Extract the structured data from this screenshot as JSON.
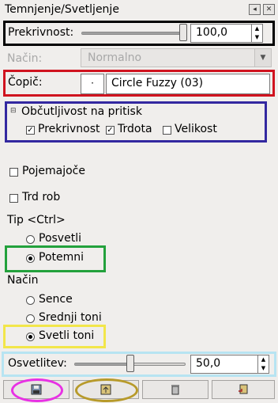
{
  "window": {
    "title": "Temnjenje/Svetljenje",
    "menu_icon": "tab-menu-icon",
    "close_icon": "close-icon"
  },
  "opacity": {
    "label": "Prekrivnost:",
    "value": "100,0",
    "slider_fraction": 1.0
  },
  "mode": {
    "label": "Način:",
    "value": "Normalno",
    "disabled": true
  },
  "brush": {
    "label": "Čopič:",
    "preview": "·",
    "name": "Circle Fuzzy (03)"
  },
  "pressure": {
    "title": "Občutljivost na pritisk",
    "options": [
      {
        "label": "Prekrivnost",
        "checked": true
      },
      {
        "label": "Trdota",
        "checked": true
      },
      {
        "label": "Velikost",
        "checked": false
      }
    ]
  },
  "options": {
    "fade": {
      "label": "Pojemajoče",
      "checked": false
    },
    "hard_edge": {
      "label": "Trd rob",
      "checked": false
    }
  },
  "type": {
    "label": "Tip  <Ctrl>",
    "options": [
      {
        "label": "Posvetli",
        "selected": false
      },
      {
        "label": "Potemni",
        "selected": true
      }
    ]
  },
  "range": {
    "label": "Način",
    "options": [
      {
        "label": "Sence",
        "selected": false
      },
      {
        "label": "Srednji toni",
        "selected": false
      },
      {
        "label": "Svetli toni",
        "selected": true
      }
    ]
  },
  "exposure": {
    "label": "Osvetlitev:",
    "value": "50,0",
    "slider_fraction": 0.5
  },
  "bottom_buttons": [
    {
      "name": "save-options-button",
      "icon": "floppy-disk-icon"
    },
    {
      "name": "restore-options-button",
      "icon": "restore-icon"
    },
    {
      "name": "delete-options-button",
      "icon": "trash-icon"
    },
    {
      "name": "reset-options-button",
      "icon": "reset-icon"
    }
  ],
  "colors": {
    "red_highlight": "#d0131f",
    "blue_highlight": "#3328a0",
    "green_highlight": "#23a13c",
    "yellow_highlight": "#f2e64a",
    "cyan_highlight": "#b7e4f2",
    "pink_highlight": "#e831e4",
    "gold_highlight": "#b79a2a"
  }
}
